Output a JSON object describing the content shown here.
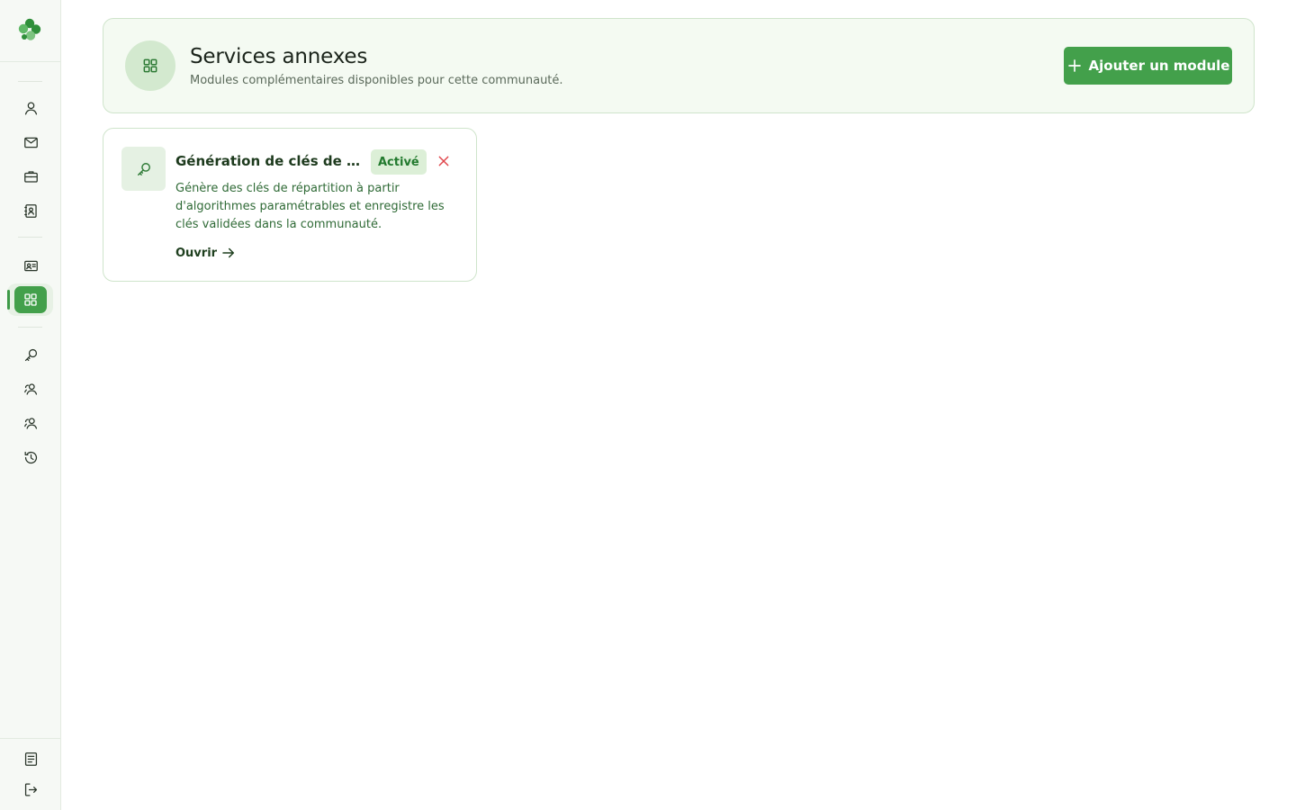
{
  "colors": {
    "accent": "#43a04b",
    "accent_light": "#e7f1e5",
    "danger": "#e0464b",
    "sidebar_bg": "#f6f9f5",
    "header_bg": "#f4faf2"
  },
  "sidebar": {
    "logo": "clover-logo",
    "top_group": [
      {
        "icon": "user-icon"
      },
      {
        "icon": "mail-icon"
      },
      {
        "icon": "briefcase-icon"
      },
      {
        "icon": "contact-book-icon"
      }
    ],
    "middle_group": [
      {
        "icon": "id-card-icon"
      },
      {
        "icon": "grid-icon",
        "active": true
      }
    ],
    "tools_group": [
      {
        "icon": "key-icon"
      },
      {
        "icon": "users-icon"
      },
      {
        "icon": "users-alt-icon"
      },
      {
        "icon": "history-icon"
      }
    ],
    "bottom_group": [
      {
        "icon": "document-icon"
      },
      {
        "icon": "logout-icon"
      }
    ]
  },
  "header": {
    "icon": "grid-icon",
    "title": "Services annexes",
    "subtitle": "Modules complémentaires disponibles pour cette communauté.",
    "add_button_label": "Ajouter un module"
  },
  "modules": [
    {
      "icon": "key-icon",
      "title": "Génération de clés de répartition",
      "badge": "Activé",
      "description": "Génère des clés de répartition à partir d'algorithmes paramétrables et enregistre les clés validées dans la communauté.",
      "open_label": "Ouvrir"
    }
  ]
}
